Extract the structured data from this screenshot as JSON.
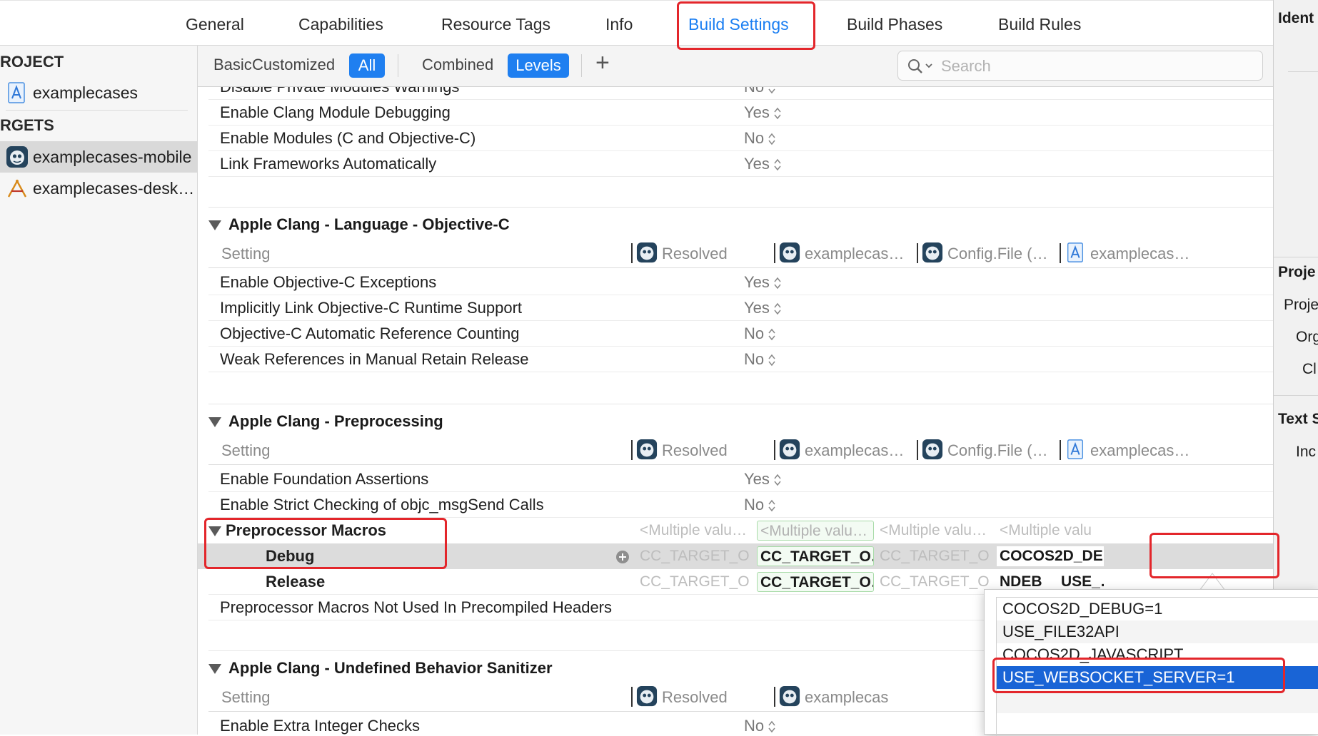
{
  "top_tabs": [
    {
      "label": "General"
    },
    {
      "label": "Capabilities"
    },
    {
      "label": "Resource Tags"
    },
    {
      "label": "Info"
    },
    {
      "label": "Build Settings"
    },
    {
      "label": "Build Phases"
    },
    {
      "label": "Build Rules"
    }
  ],
  "active_tab": "Build Settings",
  "sidebar": {
    "project_header": "ROJECT",
    "project_item": "examplecases",
    "targets_header": "RGETS",
    "targets": [
      {
        "label": "examplecases-mobile",
        "selected": true
      },
      {
        "label": "examplecases-desk…",
        "selected": false
      }
    ]
  },
  "filters": {
    "scope": [
      "Basic",
      "Customized",
      "All"
    ],
    "scope_selected": "All",
    "view": [
      "Combined",
      "Levels"
    ],
    "view_selected": "Levels",
    "add_label": "+",
    "search_placeholder": "Search"
  },
  "column_headers": {
    "setting": "Setting",
    "resolved": "Resolved",
    "target": "examplecas…",
    "config": "Config.File (…",
    "project": "examplecas…"
  },
  "rows_top": [
    {
      "name": "Disable Private Modules Warnings",
      "value": "No"
    },
    {
      "name": "Enable Clang Module Debugging",
      "value": "Yes"
    },
    {
      "name": "Enable Modules (C and Objective-C)",
      "value": "No"
    },
    {
      "name": "Link Frameworks Automatically",
      "value": "Yes"
    }
  ],
  "sections": {
    "objc": {
      "title": "Apple Clang - Language - Objective-C",
      "rows": [
        {
          "name": "Enable Objective-C Exceptions",
          "value": "Yes"
        },
        {
          "name": "Implicitly Link Objective-C Runtime Support",
          "value": "Yes"
        },
        {
          "name": "Objective-C Automatic Reference Counting",
          "value": "No"
        },
        {
          "name": "Weak References in Manual Retain Release",
          "value": "No"
        }
      ]
    },
    "preprocessing": {
      "title": "Apple Clang - Preprocessing",
      "rows": [
        {
          "name": "Enable Foundation Assertions",
          "value": "Yes"
        },
        {
          "name": "Enable Strict Checking of objc_msgSend Calls",
          "value": "No"
        }
      ],
      "macros": {
        "name": "Preprocessor Macros",
        "summary": [
          "<Multiple valu…",
          "<Multiple valu…",
          "<Multiple valu…",
          "<Multiple valu"
        ],
        "debug": {
          "label": "Debug",
          "cells": [
            "CC_TARGET_O…",
            "CC_TARGET_O…",
            "CC_TARGET_O…",
            "COCOS2D_DE…"
          ]
        },
        "release": {
          "label": "Release",
          "cells": [
            "CC_TARGET_O…",
            "CC_TARGET_O…",
            "CC_TARGET_O…",
            "NDEB"
          ],
          "extra": "USE_…"
        }
      },
      "not_used_row": "Preprocessor Macros Not Used In Precompiled Headers"
    },
    "ubsan": {
      "title": "Apple Clang - Undefined Behavior Sanitizer",
      "header_target": "examplecas",
      "rows": [
        {
          "name": "Enable Extra Integer Checks",
          "value": "No"
        }
      ]
    }
  },
  "popup_items": [
    {
      "label": "COCOS2D_DEBUG=1"
    },
    {
      "label": "USE_FILE32API"
    },
    {
      "label": "COCOS2D_JAVASCRIPT"
    },
    {
      "label": "USE_WEBSOCKET_SERVER=1"
    }
  ],
  "popup_selected": "USE_WEBSOCKET_SERVER=1",
  "inspector": [
    "Ident",
    "Proje",
    "Proje",
    "Org",
    "Cl",
    "Text S",
    "Inc"
  ],
  "colors": {
    "accent": "#1a7ef2",
    "highlight_box": "#e3262b",
    "selection": "#1964d6"
  }
}
